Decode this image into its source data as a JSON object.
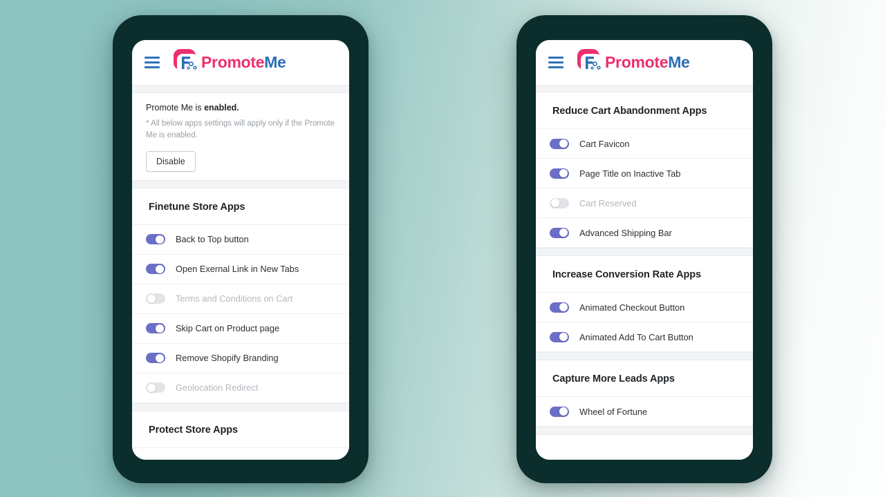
{
  "background": {
    "gradient_from": "#8cc2c0",
    "gradient_to": "#fdfefe"
  },
  "theme": {
    "frame_color": "#0b2e2c",
    "toggle_on_color": "#6b6fc8",
    "toggle_off_color": "#e2e4e7",
    "brand_pink": "#ec2f6d",
    "brand_blue": "#2c6fb4",
    "hamburger_color": "#2f72b8"
  },
  "brand": {
    "mark_icon": "promote-me-logo-icon",
    "word_1": "Promote",
    "word_2": "Me"
  },
  "phone_left": {
    "header": {
      "menu_icon": "hamburger-menu-icon"
    },
    "status": {
      "line_prefix": "Promote Me is ",
      "line_state": "enabled.",
      "note": "* All below apps settings will apply only if the Promote Me is enabled.",
      "button_label": "Disable"
    },
    "sections": [
      {
        "title": "Finetune Store Apps",
        "apps": [
          {
            "label": "Back to Top button",
            "enabled": true
          },
          {
            "label": "Open Exernal Link in New Tabs",
            "enabled": true
          },
          {
            "label": "Terms and Conditions on Cart",
            "enabled": false
          },
          {
            "label": "Skip Cart on Product page",
            "enabled": true
          },
          {
            "label": "Remove Shopify Branding",
            "enabled": true
          },
          {
            "label": "Geolocation Redirect",
            "enabled": false
          }
        ]
      },
      {
        "title": "Protect Store Apps",
        "apps": []
      }
    ]
  },
  "phone_right": {
    "header": {
      "menu_icon": "hamburger-menu-icon"
    },
    "sections": [
      {
        "title": "Reduce Cart Abandonment Apps",
        "apps": [
          {
            "label": "Cart Favicon",
            "enabled": true
          },
          {
            "label": "Page Title on Inactive Tab",
            "enabled": true
          },
          {
            "label": "Cart Reserved",
            "enabled": false
          },
          {
            "label": "Advanced Shipping Bar",
            "enabled": true
          }
        ]
      },
      {
        "title": "Increase Conversion Rate Apps",
        "apps": [
          {
            "label": "Animated Checkout Button",
            "enabled": true
          },
          {
            "label": "Animated Add To Cart Button",
            "enabled": true
          }
        ]
      },
      {
        "title": "Capture More Leads Apps",
        "apps": [
          {
            "label": "Wheel of Fortune",
            "enabled": true
          }
        ]
      }
    ]
  }
}
